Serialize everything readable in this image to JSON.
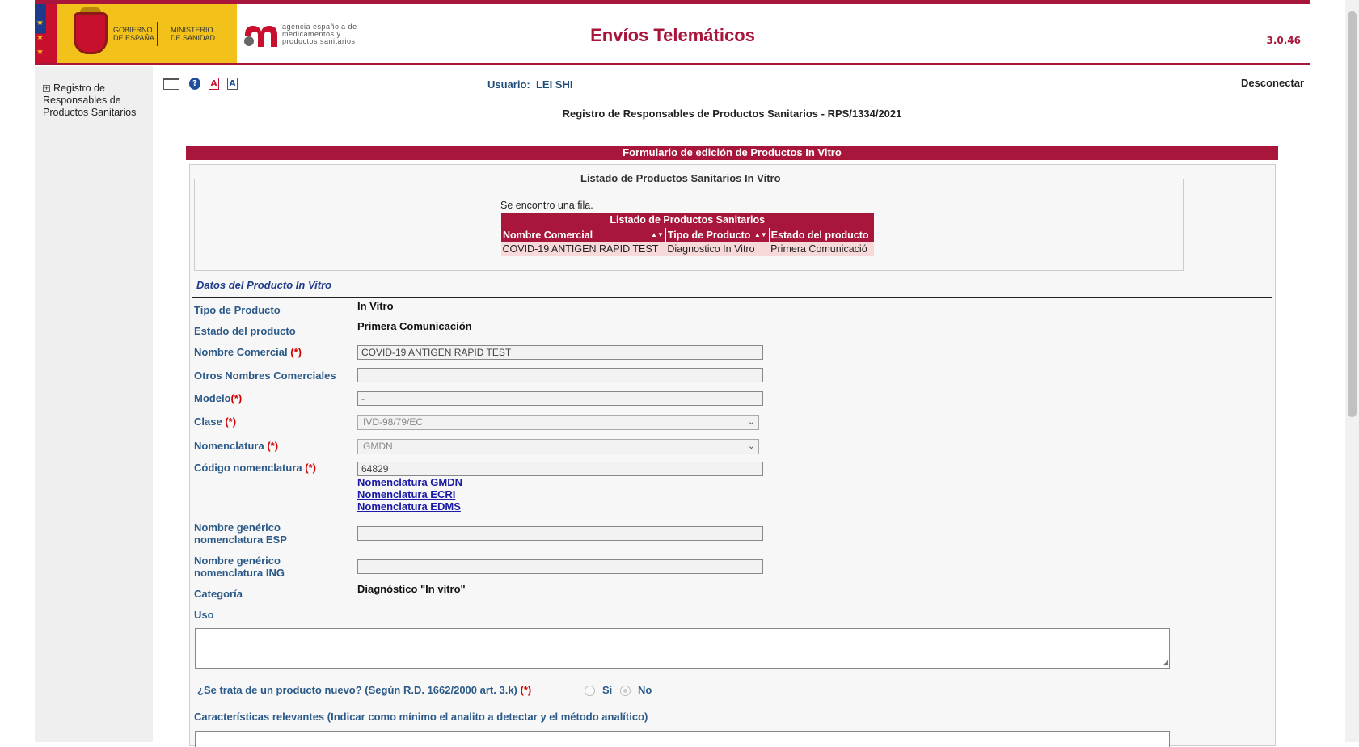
{
  "header": {
    "gov_text": "GOBIERNO DE ESPAÑA",
    "ministry_text": "MINISTERIO DE SANIDAD",
    "agency_text": "agencia española de medicamentos y productos sanitarios",
    "app_title": "Envíos Telemáticos",
    "version": "3.0.46"
  },
  "sidebar": {
    "items": [
      {
        "label": "Registro de Responsables de Productos Sanitarios"
      }
    ]
  },
  "toolbar": {
    "icons": [
      "window-icon",
      "help-icon",
      "pdf-icon",
      "text-size-icon"
    ],
    "user_label": "Usuario:",
    "user_name": "LEI SHI",
    "logout": "Desconectar"
  },
  "page": {
    "subtitle": "Registro de Responsables de Productos Sanitarios - RPS/1334/2021",
    "form_title": "Formulario de edición de Productos In Vitro"
  },
  "listing": {
    "legend": "Listado de Productos Sanitarios In Vitro",
    "found_text": "Se encontro una fila.",
    "table_caption": "Listado de Productos Sanitarios",
    "columns": [
      "Nombre Comercial",
      "Tipo de Producto",
      "Estado del producto"
    ],
    "rows": [
      [
        "COVID-19 ANTIGEN RAPID TEST",
        "Diagnostico In Vitro",
        "Primera Comunicació"
      ]
    ]
  },
  "product": {
    "section_title": "Datos del Producto In Vitro",
    "required_mark": "(*)",
    "tipo_label": "Tipo de Producto",
    "tipo_value": "In Vitro",
    "estado_label": "Estado del producto",
    "estado_value": "Primera Comunicación",
    "nombre_label": "Nombre Comercial",
    "nombre_value": "COVID-19 ANTIGEN RAPID TEST",
    "otros_label": "Otros Nombres Comerciales",
    "otros_value": "",
    "modelo_label": "Modelo",
    "modelo_value": "-",
    "clase_label": "Clase",
    "clase_value": "IVD-98/79/EC",
    "nomenclatura_label": "Nomenclatura",
    "nomenclatura_value": "GMDN",
    "codigo_label": "Código nomenclatura",
    "codigo_value": "64829",
    "links": [
      "Nomenclatura GMDN",
      "Nomenclatura ECRI",
      "Nomenclatura EDMS"
    ],
    "generico_esp_label_1": "Nombre genérico",
    "generico_esp_label_2": "nomenclatura ESP",
    "generico_esp_value": "",
    "generico_ing_label_1": "Nombre genérico",
    "generico_ing_label_2": "nomenclatura ING",
    "generico_ing_value": "",
    "categoria_label": "Categoría",
    "categoria_value": "Diagnóstico \"In vitro\"",
    "uso_label": "Uso",
    "uso_value": "",
    "nuevo_question": "¿Se trata de un producto nuevo? (Según R.D. 1662/2000 art. 3.k)",
    "nuevo_options": [
      "Si",
      "No"
    ],
    "nuevo_selected": "No",
    "caracteristicas_label": "Características relevantes (Indicar como mínimo el analito a detectar y el método analítico)"
  }
}
